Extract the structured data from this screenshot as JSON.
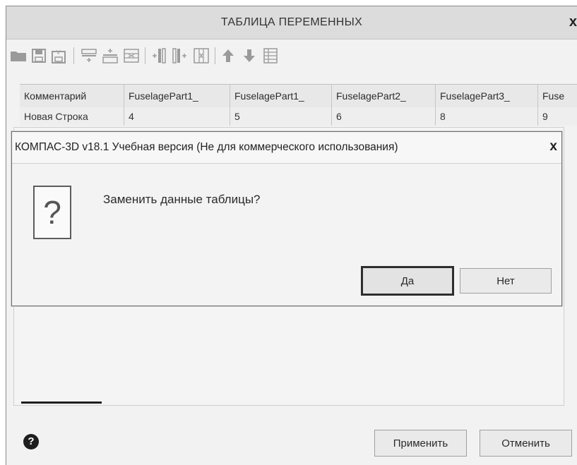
{
  "main_window": {
    "title": "ТАБЛИЦА ПЕРЕМЕННЫХ",
    "close_label": "x",
    "toolbar_icons": [
      "open-folder-icon",
      "save-icon",
      "save-as-icon",
      "insert-row-above-icon",
      "insert-row-below-icon",
      "delete-row-icon",
      "insert-column-left-icon",
      "insert-column-right-icon",
      "delete-column-icon",
      "move-up-icon",
      "move-down-icon",
      "table-settings-icon"
    ]
  },
  "table": {
    "headers": [
      "Комментарий",
      "FuselagePart1_",
      "FuselagePart1_",
      "FuselagePart2_",
      "FuselagePart3_",
      "Fuse"
    ],
    "rows": [
      [
        "Новая Строка",
        "4",
        "5",
        "6",
        "8",
        "9"
      ]
    ]
  },
  "footer": {
    "help_label": "?",
    "apply_label": "Применить",
    "cancel_label": "Отменить"
  },
  "dialog": {
    "title": "КОМПАС-3D v18.1 Учебная версия (Не для коммерческого использования)",
    "close_label": "x",
    "icon": "question-icon",
    "icon_glyph": "?",
    "message": "Заменить данные таблицы?",
    "yes_label": "Да",
    "no_label": "Нет"
  }
}
